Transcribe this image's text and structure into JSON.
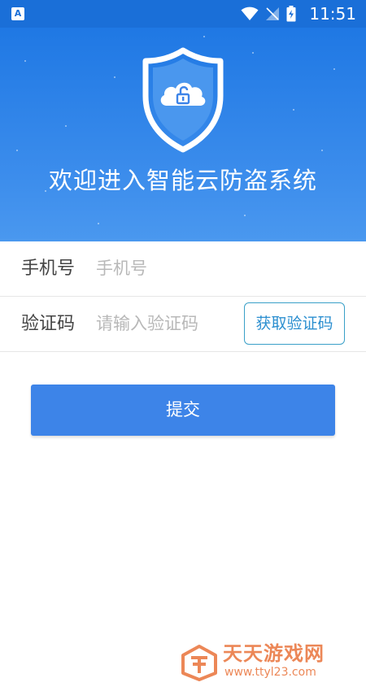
{
  "status_bar": {
    "left_icon": "A",
    "time": "11:51",
    "icons": [
      "wifi-icon",
      "no-signal-icon",
      "battery-charging-icon"
    ]
  },
  "header": {
    "title": "欢迎进入智能云防盗系统",
    "logo_icon": "shield-cloud-unlock-icon"
  },
  "form": {
    "phone": {
      "label": "手机号",
      "placeholder": "手机号",
      "value": ""
    },
    "code": {
      "label": "验证码",
      "placeholder": "请输入验证码",
      "value": "",
      "get_code_label": "获取验证码"
    }
  },
  "submit_label": "提交",
  "watermark": {
    "name": "天天游戏网",
    "url": "www.ttyl23.com"
  },
  "colors": {
    "header_blue": "#1f78e4",
    "button_blue": "#3d84e8",
    "code_button_border": "#3aa0c8",
    "watermark_orange": "#e9733a"
  }
}
